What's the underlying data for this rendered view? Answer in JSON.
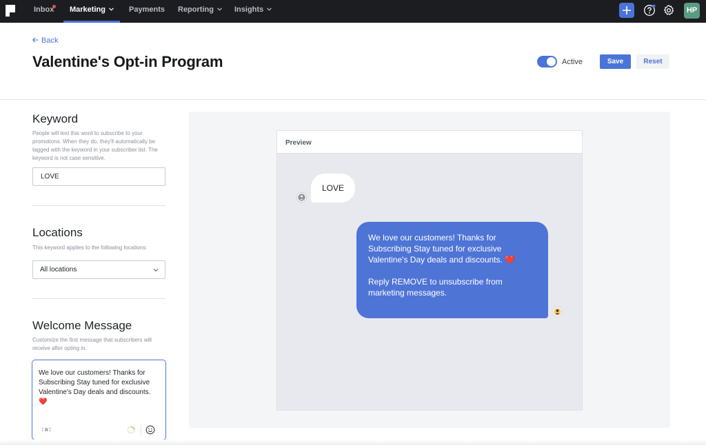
{
  "nav": {
    "items": [
      {
        "label": "Inbox",
        "has_badge": true
      },
      {
        "label": "Marketing",
        "active": true,
        "has_chevron": true
      },
      {
        "label": "Payments"
      },
      {
        "label": "Reporting",
        "has_chevron": true
      },
      {
        "label": "Insights",
        "has_chevron": true
      }
    ],
    "user_initials": "HP",
    "accent_color": "#4b74d8",
    "badge_color": "#e0544c"
  },
  "header": {
    "back_label": "Back",
    "title": "Valentine's Opt-in Program",
    "status_label": "Active",
    "status_on": true,
    "save_label": "Save",
    "reset_label": "Reset"
  },
  "keyword": {
    "title": "Keyword",
    "description": "People will text this word to subscribe to your promotions. When they do, they'll automatically be tagged with the keyword in your subscriber list. The keyword is not case sensitive.",
    "value": "LOVE"
  },
  "locations": {
    "title": "Locations",
    "description": "This keyword applies to the following locations:",
    "selected": "All locations"
  },
  "welcome": {
    "title": "Welcome Message",
    "description": "Customize the first message that subscribers will receive after opting in.",
    "message": "We love our customers! Thanks for Subscribing  Stay tuned for exclusive Valentine's Day deals and discounts. ❤️",
    "merge_tag": ":a:"
  },
  "preview": {
    "label": "Preview",
    "incoming": "LOVE",
    "outgoing_main": "We love our customers! Thanks for Subscribing Stay tuned for exclusive Valentine's Day deals and discounts. ❤️",
    "outgoing_unsub": "Reply REMOVE to unsubscribe from marketing messages."
  }
}
